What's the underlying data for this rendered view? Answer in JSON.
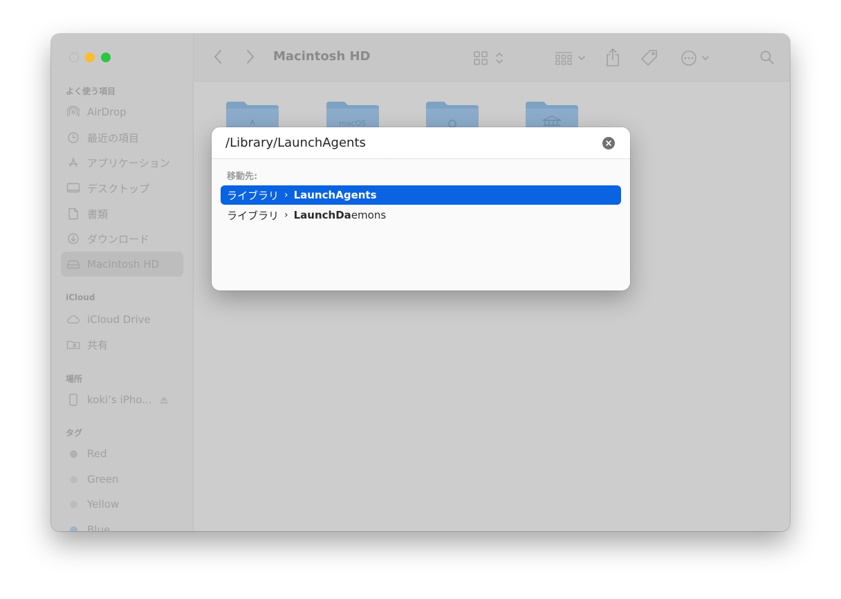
{
  "window": {
    "title": "Macintosh HD"
  },
  "sidebar": {
    "sections": [
      {
        "heading": "よく使う項目",
        "items": [
          {
            "label": "AirDrop",
            "icon": "airdrop-icon"
          },
          {
            "label": "最近の項目",
            "icon": "clock-icon"
          },
          {
            "label": "アプリケーション",
            "icon": "applications-icon"
          },
          {
            "label": "デスクトップ",
            "icon": "desktop-icon"
          },
          {
            "label": "書類",
            "icon": "document-icon"
          },
          {
            "label": "ダウンロード",
            "icon": "download-icon"
          },
          {
            "label": "Macintosh HD",
            "icon": "disk-icon",
            "active": true
          }
        ]
      },
      {
        "heading": "iCloud",
        "items": [
          {
            "label": "iCloud Drive",
            "icon": "cloud-icon"
          },
          {
            "label": "共有",
            "icon": "shared-folder-icon"
          }
        ]
      },
      {
        "heading": "場所",
        "items": [
          {
            "label": "koki’s iPho...",
            "icon": "iphone-icon"
          }
        ]
      },
      {
        "heading": "タグ",
        "items": [
          {
            "label": "Red",
            "icon": "tag-dot-icon"
          },
          {
            "label": "Green",
            "icon": "tag-dot-icon"
          },
          {
            "label": "Yellow",
            "icon": "tag-dot-icon"
          },
          {
            "label": "Blue",
            "icon": "tag-dot-icon"
          }
        ]
      }
    ]
  },
  "content": {
    "folder_labels": [
      "",
      "macOS",
      "",
      ""
    ]
  },
  "goto_dialog": {
    "input_value": "/Library/LaunchAgents",
    "section_label": "移動先:",
    "suggestions": [
      {
        "parent": "ライブラリ",
        "separator": "›",
        "name_bold": "LaunchAgents",
        "name_rest": "",
        "selected": true
      },
      {
        "parent": "ライブラリ",
        "separator": "›",
        "name_bold": "LaunchDa",
        "name_rest": "emons",
        "selected": false
      }
    ]
  },
  "colors": {
    "selection": "#0a63e0",
    "tag_red": "#b2b2b2",
    "tag_blue": "#a0b4c6",
    "folder": "#7ea2c4"
  }
}
